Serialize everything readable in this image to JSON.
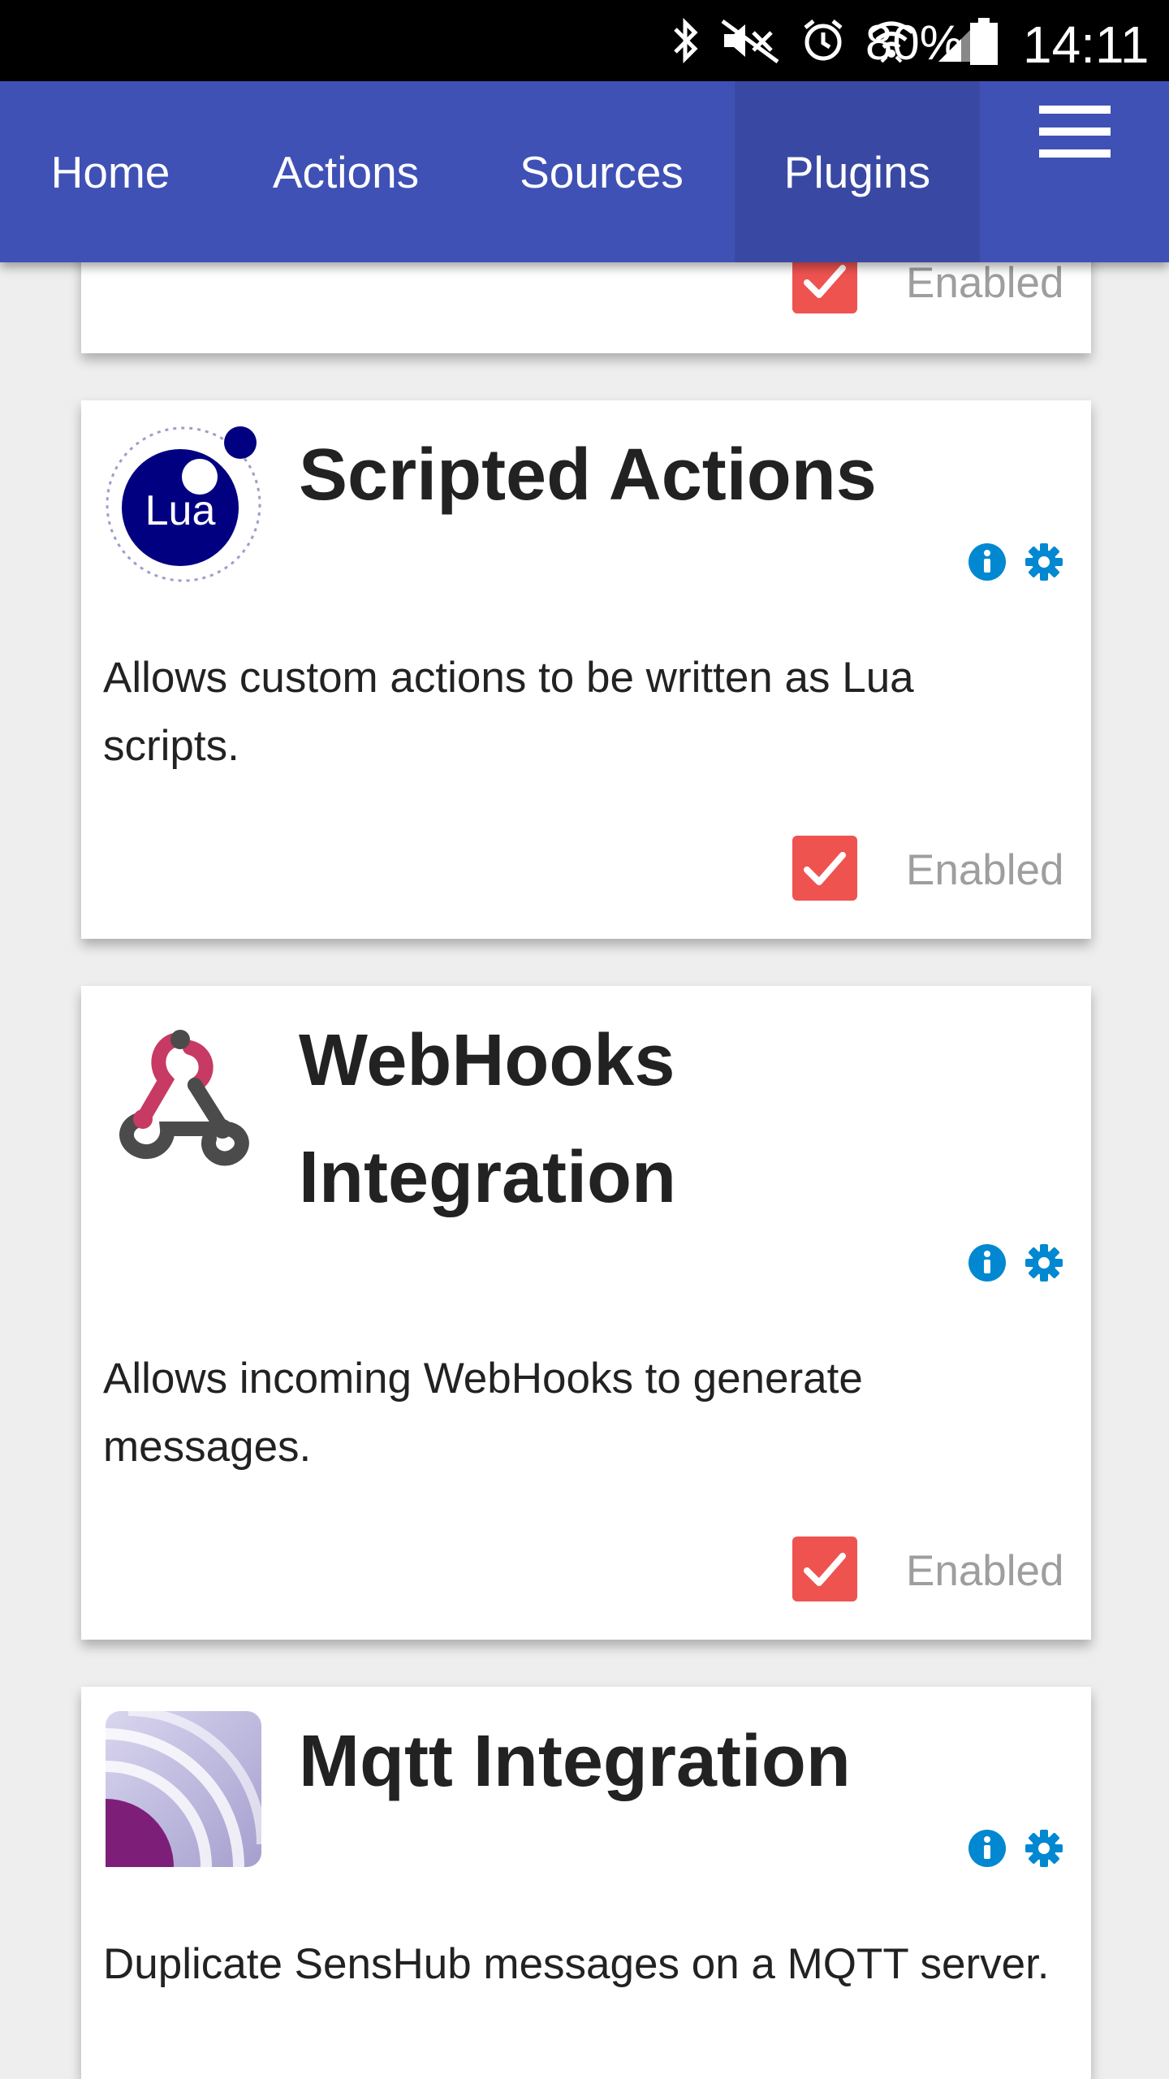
{
  "status_bar": {
    "battery_percent": "80%",
    "time": "14:11",
    "icons": [
      "bluetooth-icon",
      "mute-icon",
      "alarm-icon",
      "wifi-icon",
      "signal-icon",
      "battery-icon"
    ]
  },
  "nav": {
    "tabs": [
      {
        "label": "Home"
      },
      {
        "label": "Actions"
      },
      {
        "label": "Sources"
      },
      {
        "label": "Plugins"
      }
    ],
    "active_tab": "Plugins",
    "menu_icon": "hamburger-menu-icon"
  },
  "colors": {
    "nav_bg": "#3f51b5",
    "nav_active_bg": "#3949a3",
    "checkbox": "#ef5350",
    "action_icons": "#0288d1"
  },
  "previous_card": {
    "enabled_label": "Enabled",
    "checked": true
  },
  "plugins": [
    {
      "title": "Scripted Actions",
      "logo": "lua-logo",
      "logo_text": "Lua",
      "description": "Allows custom actions to be written as Lua scripts.",
      "enabled_label": "Enabled",
      "checked": true
    },
    {
      "title_line1": "WebHooks",
      "title_line2": "Integration",
      "logo": "webhooks-logo",
      "description": "Allows incoming WebHooks to generate messages.",
      "enabled_label": "Enabled",
      "checked": true
    },
    {
      "title": "Mqtt Integration",
      "logo": "mqtt-logo",
      "description": "Duplicate SensHub messages on a MQTT server."
    }
  ]
}
